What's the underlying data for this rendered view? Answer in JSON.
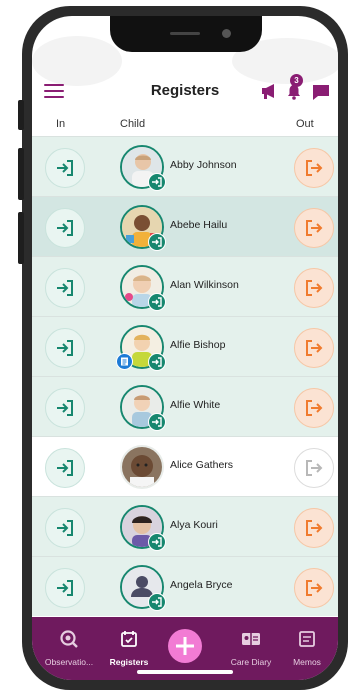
{
  "header": {
    "title": "Registers",
    "notification_count": "3"
  },
  "columns": {
    "in": "In",
    "child": "Child",
    "out": "Out"
  },
  "children": [
    {
      "name": "Abby Johnson"
    },
    {
      "name": "Abebe Hailu"
    },
    {
      "name": "Alan Wilkinson"
    },
    {
      "name": "Alfie Bishop"
    },
    {
      "name": "Alfie White"
    },
    {
      "name": "Alice Gathers"
    },
    {
      "name": "Alya Kouri"
    },
    {
      "name": "Angela Bryce"
    }
  ],
  "tabs": {
    "observations": "Observatio...",
    "registers": "Registers",
    "care_diary": "Care Diary",
    "memos": "Memos"
  },
  "icons": {
    "menu": "hamburger-icon",
    "announce": "megaphone-icon",
    "notify": "bell-icon",
    "messages": "chat-icon",
    "sign_in": "sign-in-icon",
    "sign_out": "sign-out-icon",
    "add": "plus-icon"
  },
  "colors": {
    "brand": "#8a1d73",
    "tabbar": "#6f1a5e",
    "checked_in": "#17876f",
    "sign_out": "#f07b2e",
    "row_bg": "#e4f1ec"
  }
}
